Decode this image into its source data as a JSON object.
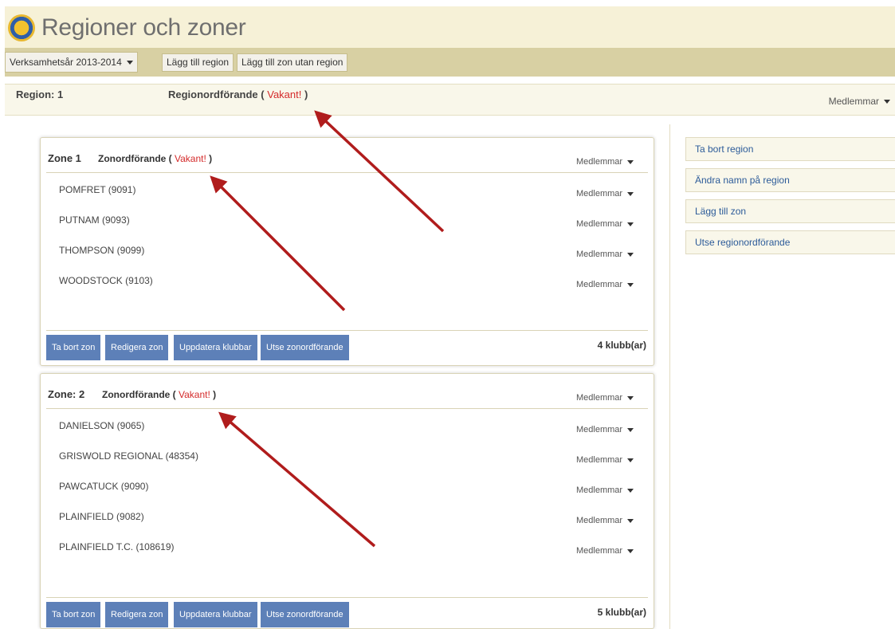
{
  "header": {
    "title": "Regioner och zoner",
    "logo_icon": "lions-club-logo"
  },
  "toolbar": {
    "year_select": "Verksamhetsår 2013-2014",
    "add_region": "Lägg till region",
    "add_zone_without_region": "Lägg till zon utan region"
  },
  "region": {
    "label": "Region: 1",
    "leader_prefix": "Regionordförande (",
    "leader_status": "Vakant!",
    "leader_suffix": ")",
    "members": "Medlemmar"
  },
  "sidebar": {
    "items": [
      "Ta bort region",
      "Ändra namn på region",
      "Lägg till zon",
      "Utse regionordförande"
    ]
  },
  "zones": [
    {
      "name": "Zone 1",
      "leader_prefix": "Zonordförande (",
      "leader_status": "Vakant!",
      "leader_suffix": ")",
      "members": "Medlemmar",
      "clubs": [
        {
          "name": "POMFRET (9091)",
          "members": "Medlemmar"
        },
        {
          "name": "PUTNAM (9093)",
          "members": "Medlemmar"
        },
        {
          "name": "THOMPSON (9099)",
          "members": "Medlemmar"
        },
        {
          "name": "WOODSTOCK (9103)",
          "members": "Medlemmar"
        }
      ],
      "buttons": [
        "Ta bort zon",
        "Redigera zon",
        "Uppdatera klubbar",
        "Utse zonordförande"
      ],
      "club_count": "4  klubb(ar)"
    },
    {
      "name": "Zone: 2",
      "leader_prefix": "Zonordförande (",
      "leader_status": "Vakant!",
      "leader_suffix": ")",
      "members": "Medlemmar",
      "clubs": [
        {
          "name": "DANIELSON (9065)",
          "members": "Medlemmar"
        },
        {
          "name": "GRISWOLD REGIONAL (48354)",
          "members": "Medlemmar"
        },
        {
          "name": "PAWCATUCK (9090)",
          "members": "Medlemmar"
        },
        {
          "name": "PLAINFIELD (9082)",
          "members": "Medlemmar"
        },
        {
          "name": "PLAINFIELD T.C. (108619)",
          "members": "Medlemmar"
        }
      ],
      "buttons": [
        "Ta bort zon",
        "Redigera zon",
        "Uppdatera klubbar",
        "Utse zonordförande"
      ],
      "club_count": "5  klubb(ar)"
    }
  ],
  "colors": {
    "accent_blue": "#5d80b8",
    "vakant_red": "#d42a2a",
    "header_bg": "#f6f1d7",
    "toolbar_bg": "#d8d0a3",
    "arrow_red": "#b01c1c"
  }
}
